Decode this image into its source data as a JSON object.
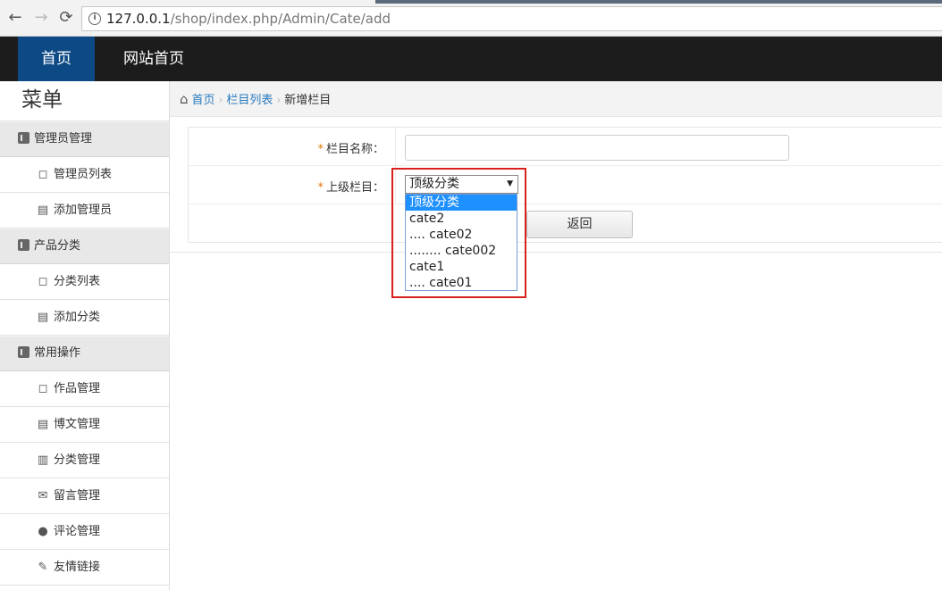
{
  "browser": {
    "back_icon": "←",
    "forward_icon": "→",
    "reload_icon": "⟳",
    "info_icon": "i",
    "url_host": "127.0.0.1",
    "url_path": "/shop/index.php/Admin/Cate/add"
  },
  "navbar": {
    "items": [
      {
        "label": "首页",
        "active": true
      },
      {
        "label": "网站首页",
        "active": false
      }
    ]
  },
  "sidebar": {
    "title": "菜单",
    "groups": [
      {
        "label": "管理员管理",
        "items": [
          {
            "label": "管理员列表",
            "icon": "◻"
          },
          {
            "label": "添加管理员",
            "icon": "▤"
          }
        ]
      },
      {
        "label": "产品分类",
        "items": [
          {
            "label": "分类列表",
            "icon": "◻"
          },
          {
            "label": "添加分类",
            "icon": "▤"
          }
        ]
      },
      {
        "label": "常用操作",
        "items": [
          {
            "label": "作品管理",
            "icon": "◻"
          },
          {
            "label": "博文管理",
            "icon": "▤"
          },
          {
            "label": "分类管理",
            "icon": "▥"
          },
          {
            "label": "留言管理",
            "icon": "✉"
          },
          {
            "label": "评论管理",
            "icon": "●"
          },
          {
            "label": "友情链接",
            "icon": "✎"
          }
        ]
      }
    ]
  },
  "breadcrumb": {
    "home_icon": "⌂",
    "home": "首页",
    "list": "栏目列表",
    "current": "新增栏目",
    "separator": "›"
  },
  "form": {
    "name_label": "栏目名称：",
    "name_value": "",
    "parent_label": "上级栏目：",
    "required_mark": "*",
    "back_button": "返回"
  },
  "dropdown": {
    "selected": "顶级分类",
    "arrow": "▼",
    "options": [
      {
        "label": "顶级分类",
        "selected": true
      },
      {
        "label": "cate2",
        "selected": false
      },
      {
        "label": ".... cate02",
        "selected": false
      },
      {
        "label": "........ cate002",
        "selected": false
      },
      {
        "label": "cate1",
        "selected": false
      },
      {
        "label": ".... cate01",
        "selected": false
      }
    ]
  },
  "colors": {
    "navbar_bg": "#1c1c1c",
    "navbar_active": "#0d4a85",
    "link": "#2a7bbf",
    "required": "#e07a10",
    "highlight": "#d9211c",
    "option_selected": "#1e90ff"
  }
}
